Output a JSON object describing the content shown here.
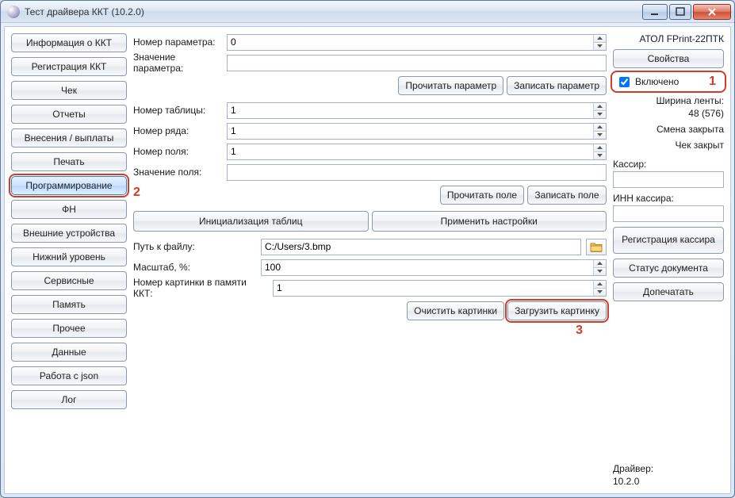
{
  "window": {
    "title": "Тест драйвера ККТ (10.2.0)"
  },
  "sidebar": {
    "items": [
      "Информация о ККТ",
      "Регистрация ККТ",
      "Чек",
      "Отчеты",
      "Внесения / выплаты",
      "Печать",
      "Программирование",
      "ФН",
      "Внешние устройства",
      "Нижний уровень",
      "Сервисные",
      "Память",
      "Прочее",
      "Данные",
      "Работа с json",
      "Лог"
    ],
    "active_index": 6
  },
  "form": {
    "param_number_label": "Номер параметра:",
    "param_number_value": "0",
    "param_value_label": "Значение параметра:",
    "param_value_value": "",
    "read_param": "Прочитать параметр",
    "write_param": "Записать параметр",
    "table_number_label": "Номер таблицы:",
    "table_number_value": "1",
    "row_number_label": "Номер ряда:",
    "row_number_value": "1",
    "field_number_label": "Номер поля:",
    "field_number_value": "1",
    "field_value_label": "Значение поля:",
    "field_value_value": "",
    "read_field": "Прочитать поле",
    "write_field": "Записать поле",
    "init_tables": "Инициализация таблиц",
    "apply_settings": "Применить настройки",
    "file_path_label": "Путь к файлу:",
    "file_path_value": "C:/Users/3.bmp",
    "scale_label": "Масштаб, %:",
    "scale_value": "100",
    "pic_index_label": "Номер картинки в памяти ККТ:",
    "pic_index_value": "1",
    "clear_pics": "Очистить картинки",
    "load_pic": "Загрузить картинку"
  },
  "right": {
    "device_name": "АТОЛ FPrint-22ПТК",
    "properties_btn": "Свойства",
    "enabled_label": "Включено",
    "tape_width_label": "Ширина ленты:",
    "tape_width_value": "48 (576)",
    "shift_status": "Смена закрыта",
    "receipt_status": "Чек закрыт",
    "cashier_label": "Кассир:",
    "cashier_value": "",
    "cashier_inn_label": "ИНН кассира:",
    "cashier_inn_value": "",
    "reg_cashier_btn": "Регистрация кассира",
    "doc_status_btn": "Статус документа",
    "reprint_btn": "Допечатать",
    "driver_label": "Драйвер:",
    "driver_version": "10.2.0"
  },
  "annotations": {
    "a1": "1",
    "a2": "2",
    "a3": "3"
  }
}
